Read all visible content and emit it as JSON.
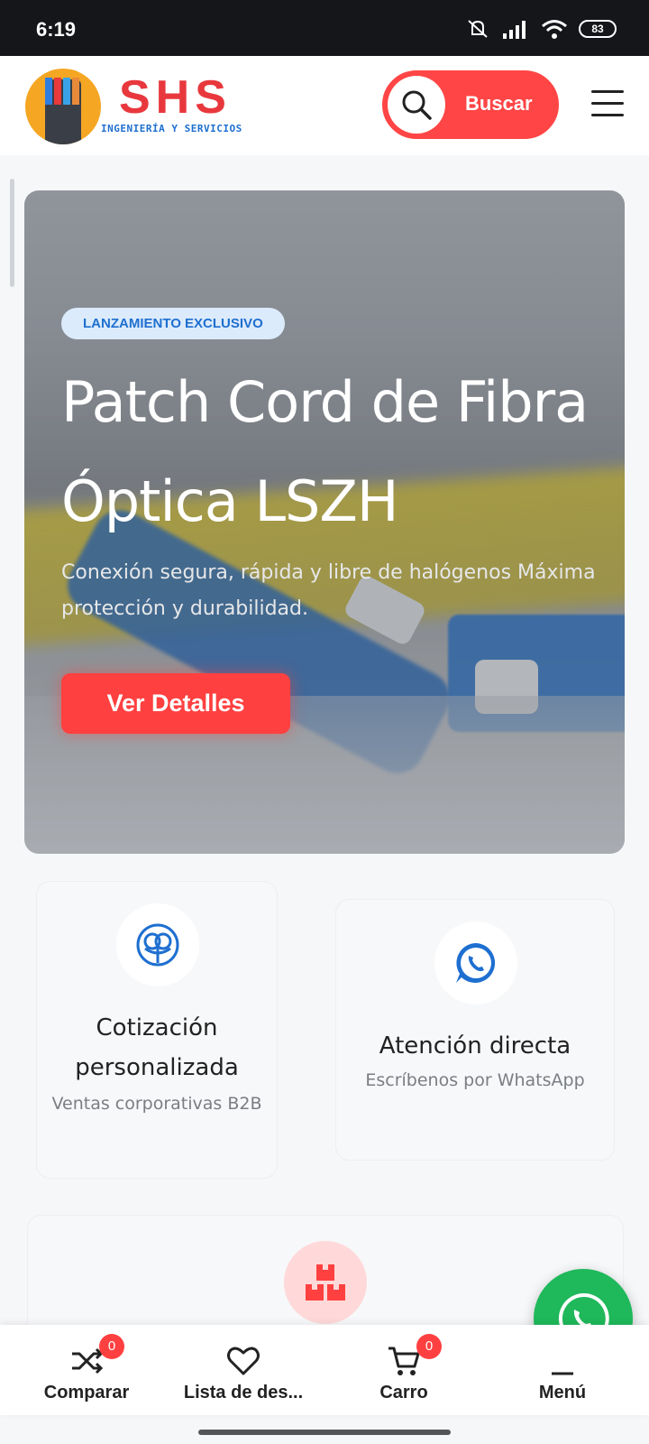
{
  "status_bar": {
    "time": "6:19",
    "battery": "83"
  },
  "header": {
    "logo_text": "SHS",
    "logo_subtitle": "INGENIERÍA Y SERVICIOS",
    "search_label": "Buscar"
  },
  "hero": {
    "badge": "LANZAMIENTO EXCLUSIVO",
    "title": "Patch Cord de Fibra Óptica LSZH",
    "description": "Conexión segura, rápida y libre de halógenos Máxima protección y durabilidad.",
    "button_label": "Ver Detalles"
  },
  "features": [
    {
      "title": "Cotización personalizada",
      "subtitle": "Ventas corporativas B2B",
      "icon": "quote-icon"
    },
    {
      "title": "Atención directa",
      "subtitle": "Escríbenos por WhatsApp",
      "icon": "whatsapp-icon"
    },
    {
      "title": "",
      "subtitle": "",
      "icon": "boxes-icon"
    }
  ],
  "bottom_nav": [
    {
      "label": "Comparar",
      "count": "0",
      "icon": "shuffle-icon"
    },
    {
      "label": "Lista de des...",
      "icon": "heart-icon"
    },
    {
      "label": "Carro",
      "count": "0",
      "icon": "cart-icon"
    },
    {
      "label": "Menú",
      "icon": "menu-icon"
    }
  ],
  "colors": {
    "accent": "#ff4040",
    "brand_blue": "#1e6fd0",
    "whatsapp": "#1fb85a"
  }
}
